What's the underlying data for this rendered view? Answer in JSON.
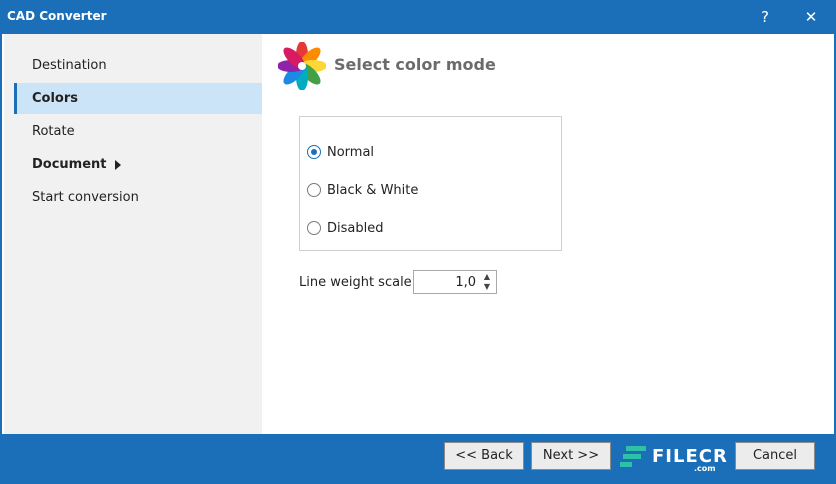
{
  "window": {
    "title": "CAD Converter",
    "help_glyph": "?",
    "close_glyph": "✕"
  },
  "nav": {
    "items": [
      {
        "label": "Destination"
      },
      {
        "label": "Colors"
      },
      {
        "label": "Rotate"
      },
      {
        "label": "Document"
      },
      {
        "label": "Start conversion"
      }
    ]
  },
  "content": {
    "heading": "Select color mode",
    "radios": [
      {
        "label": "Normal",
        "checked": true
      },
      {
        "label": "Black & White",
        "checked": false
      },
      {
        "label": "Disabled",
        "checked": false
      }
    ],
    "line_weight": {
      "label": "Line weight scale:",
      "value": "1,0"
    }
  },
  "footer": {
    "back_label": "<< Back",
    "next_label": "Next >>",
    "cancel_label": "Cancel",
    "watermark": "FILECR",
    "watermark_sub": ".com"
  },
  "colors": {
    "accent": "#1a6fb8",
    "nav_bg": "#f1f1f1",
    "selected_bg": "#cce4f7"
  }
}
